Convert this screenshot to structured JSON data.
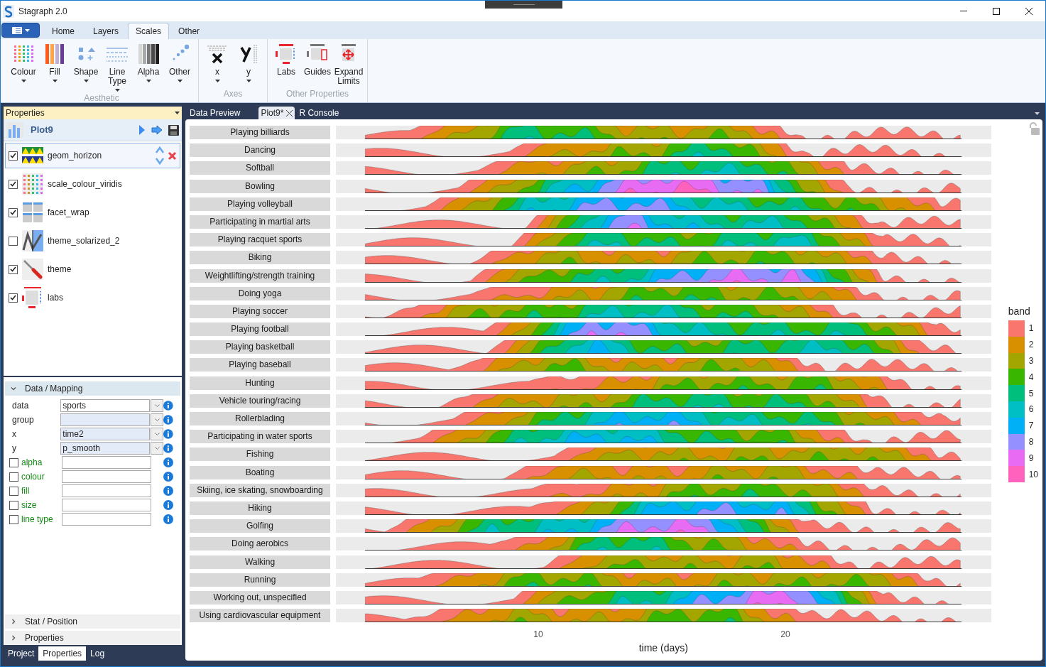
{
  "window": {
    "title": "Stagraph 2.0"
  },
  "ribbon_tabs": [
    {
      "label": "Home",
      "selected": false
    },
    {
      "label": "Layers",
      "selected": false
    },
    {
      "label": "Scales",
      "selected": true
    },
    {
      "label": "Other",
      "selected": false
    }
  ],
  "ribbon_groups": [
    {
      "label": "Aesthetic",
      "buttons": [
        {
          "label": "Colour",
          "dropdown": true
        },
        {
          "label": "Fill",
          "dropdown": true
        },
        {
          "label": "Shape",
          "dropdown": true
        },
        {
          "label": "Line Type",
          "dropdown": true
        },
        {
          "label": "Alpha",
          "dropdown": true
        },
        {
          "label": "Other",
          "dropdown": true
        }
      ]
    },
    {
      "label": "Axes",
      "buttons": [
        {
          "label": "x",
          "dropdown": true
        },
        {
          "label": "y",
          "dropdown": true
        }
      ]
    },
    {
      "label": "Other Properties",
      "buttons": [
        {
          "label": "Labs",
          "dropdown": false
        },
        {
          "label": "Guides",
          "dropdown": false
        },
        {
          "label": "Expand Limits",
          "dropdown": false
        }
      ]
    }
  ],
  "properties_panel": {
    "title": "Properties",
    "plot_name": "Plot9",
    "layers": [
      {
        "label": "geom_horizon",
        "checked": true,
        "selected": true
      },
      {
        "label": "scale_colour_viridis",
        "checked": true,
        "selected": false
      },
      {
        "label": "facet_wrap",
        "checked": true,
        "selected": false
      },
      {
        "label": "theme_solarized_2",
        "checked": false,
        "selected": false
      },
      {
        "label": "theme",
        "checked": true,
        "selected": false
      },
      {
        "label": "labs",
        "checked": true,
        "selected": false
      }
    ],
    "sections": [
      {
        "label": "Data / Mapping",
        "expanded": true
      },
      {
        "label": "Stat / Position",
        "expanded": false
      },
      {
        "label": "Properties",
        "expanded": false
      }
    ],
    "mappings": [
      {
        "kind": "select",
        "label": "data",
        "value": "sports",
        "highlighted": false
      },
      {
        "kind": "select",
        "label": "group",
        "highlighted": true
      },
      {
        "kind": "select",
        "label": "x",
        "value": "time2",
        "highlighted": true
      },
      {
        "kind": "select",
        "label": "y",
        "value": "p_smooth",
        "highlighted": true
      },
      {
        "kind": "check",
        "label": "alpha",
        "checked": false
      },
      {
        "kind": "check",
        "label": "colour",
        "checked": false
      },
      {
        "kind": "check",
        "label": "fill",
        "checked": false
      },
      {
        "kind": "check",
        "label": "size",
        "checked": false
      },
      {
        "kind": "check",
        "label": "line type",
        "checked": false
      }
    ]
  },
  "bottom_tabs": [
    {
      "label": "Project",
      "selected": false
    },
    {
      "label": "Properties",
      "selected": true
    },
    {
      "label": "Log",
      "selected": false
    }
  ],
  "document_tabs": [
    {
      "label": "Data Preview",
      "selected": false,
      "closable": false
    },
    {
      "label": "Plot9*",
      "selected": true,
      "closable": true
    },
    {
      "label": "R Console",
      "selected": false,
      "closable": false
    }
  ],
  "plot": {
    "facets": [
      "Playing billiards",
      "Dancing",
      "Softball",
      "Bowling",
      "Playing volleyball",
      "Participating in martial arts",
      "Playing racquet sports",
      "Biking",
      "Weightlifting/strength training",
      "Doing yoga",
      "Playing soccer",
      "Playing football",
      "Playing basketball",
      "Playing baseball",
      "Hunting",
      "Vehicle touring/racing",
      "Rollerblading",
      "Participating in water sports",
      "Fishing",
      "Boating",
      "Skiing, ice skating, snowboarding",
      "Hiking",
      "Golfing",
      "Doing aerobics",
      "Walking",
      "Running",
      "Working out, unspecified",
      "Using cardiovascular equipment"
    ],
    "x_ticks": [
      "10",
      "20"
    ],
    "xlabel": "time (days)",
    "legend": {
      "title": "band",
      "items": [
        {
          "label": "1",
          "color": "#f8766d"
        },
        {
          "label": "2",
          "color": "#d89000"
        },
        {
          "label": "3",
          "color": "#a3a500"
        },
        {
          "label": "4",
          "color": "#39b600"
        },
        {
          "label": "5",
          "color": "#00bf7d"
        },
        {
          "label": "6",
          "color": "#00bfc4"
        },
        {
          "label": "7",
          "color": "#00b0f6"
        },
        {
          "label": "8",
          "color": "#9590ff"
        },
        {
          "label": "9",
          "color": "#e76bf3"
        },
        {
          "label": "10",
          "color": "#ff62bc"
        }
      ]
    }
  }
}
